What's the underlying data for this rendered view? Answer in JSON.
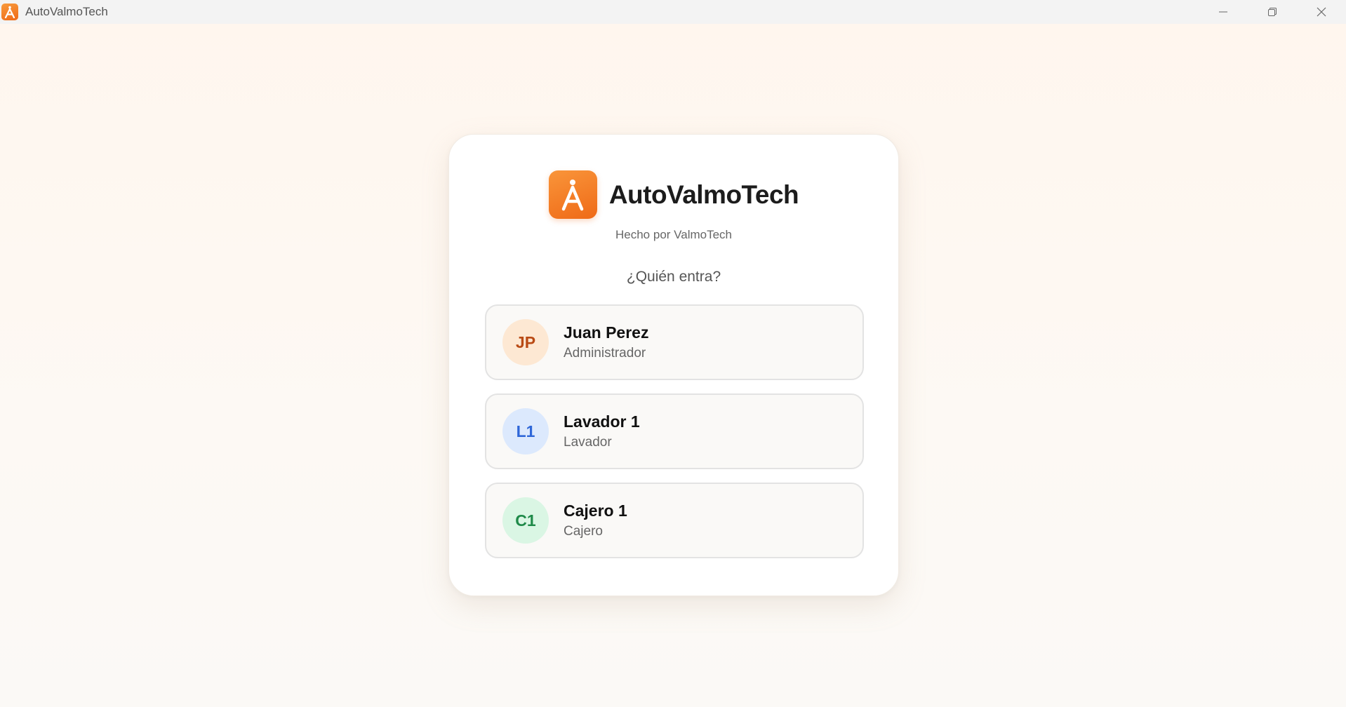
{
  "window": {
    "title": "AutoValmoTech",
    "logo_glyph": "Å",
    "controls": [
      "minimize-icon",
      "restore-icon",
      "close-icon"
    ]
  },
  "brand": {
    "logo_glyph": "Å",
    "name": "AutoValmoTech",
    "subtitle": "Hecho por ValmoTech",
    "accent_color": "#f07a22"
  },
  "login": {
    "question": "¿Quién entra?",
    "users": [
      {
        "initials": "JP",
        "name": "Juan Perez",
        "role": "Administrador",
        "avatar_bg": "#fde8d3",
        "avatar_fg": "#b94a14"
      },
      {
        "initials": "L1",
        "name": "Lavador 1",
        "role": "Lavador",
        "avatar_bg": "#dce9fd",
        "avatar_fg": "#2f67d8"
      },
      {
        "initials": "C1",
        "name": "Cajero 1",
        "role": "Cajero",
        "avatar_bg": "#daf6e4",
        "avatar_fg": "#1f8a49"
      }
    ]
  }
}
